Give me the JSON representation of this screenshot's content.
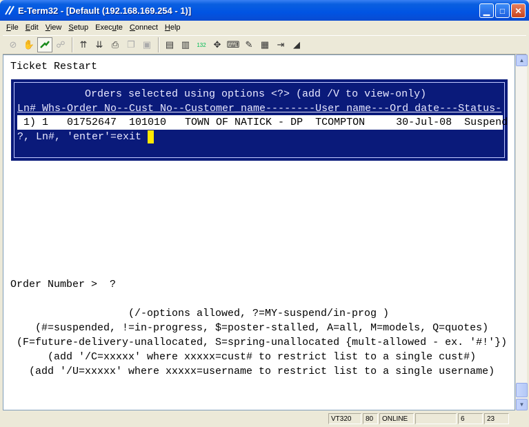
{
  "window": {
    "title": "E-Term32 - [Default (192.168.169.254 - 1)]",
    "minimize_glyph": "▁",
    "maximize_glyph": "□",
    "close_glyph": "✕"
  },
  "menu": [
    "File",
    "Edit",
    "View",
    "Setup",
    "Execute",
    "Connect",
    "Help"
  ],
  "menu_underline": [
    "F",
    "E",
    "V",
    "S",
    "u",
    "C",
    "H"
  ],
  "toolbar": {
    "icons": [
      "cancel-icon",
      "hand-icon",
      "connect-icon",
      "disconnect-icon",
      "send-file-icon",
      "receive-file-icon",
      "print-icon",
      "copy-icon",
      "paste-icon",
      "screen-print-icon",
      "screen-capture-icon",
      "keypad-132-icon",
      "hotspot-icon",
      "keyboard-icon",
      "script-icon",
      "macro-icon",
      "exit-icon",
      "edit-icon"
    ]
  },
  "terminal": {
    "screen_title": "Ticket Restart",
    "panel_title": "Orders selected using options <?> (add /V to view-only)",
    "header": "Ln# Whs-Order_No--Cust_No--Customer_name--------User_name---Ord_date---Status-",
    "rows": [
      " 1) 1   01752647  101010   TOWN OF NATICK - DP  TCOMPTON     30-Jul-08  Suspend"
    ],
    "prompt_line": "?, Ln#, 'enter'=exit ",
    "order_prompt": "Order Number >  ?",
    "help_lines": [
      "(/-options allowed, ?=MY-suspend/in-prog )",
      "(#=suspended, !=in-progress, $=poster-stalled, A=all, M=models, Q=quotes)",
      "(F=future-delivery-unallocated, S=spring-unallocated {mult-allowed - ex. '#!'})",
      "(add '/C=xxxxx' where xxxxx=cust# to restrict list to a single cust#)",
      "(add '/U=xxxxx' where xxxxx=username to restrict list to a single username)"
    ]
  },
  "statusbar": {
    "emulation": "VT320",
    "columns": "80",
    "state": "ONLINE",
    "cursor_row": "6",
    "cursor_col": "23"
  },
  "colors": {
    "panel_bg": "#0a1a7a",
    "cursor": "#ffe800",
    "titlebar": "#0054e3"
  }
}
